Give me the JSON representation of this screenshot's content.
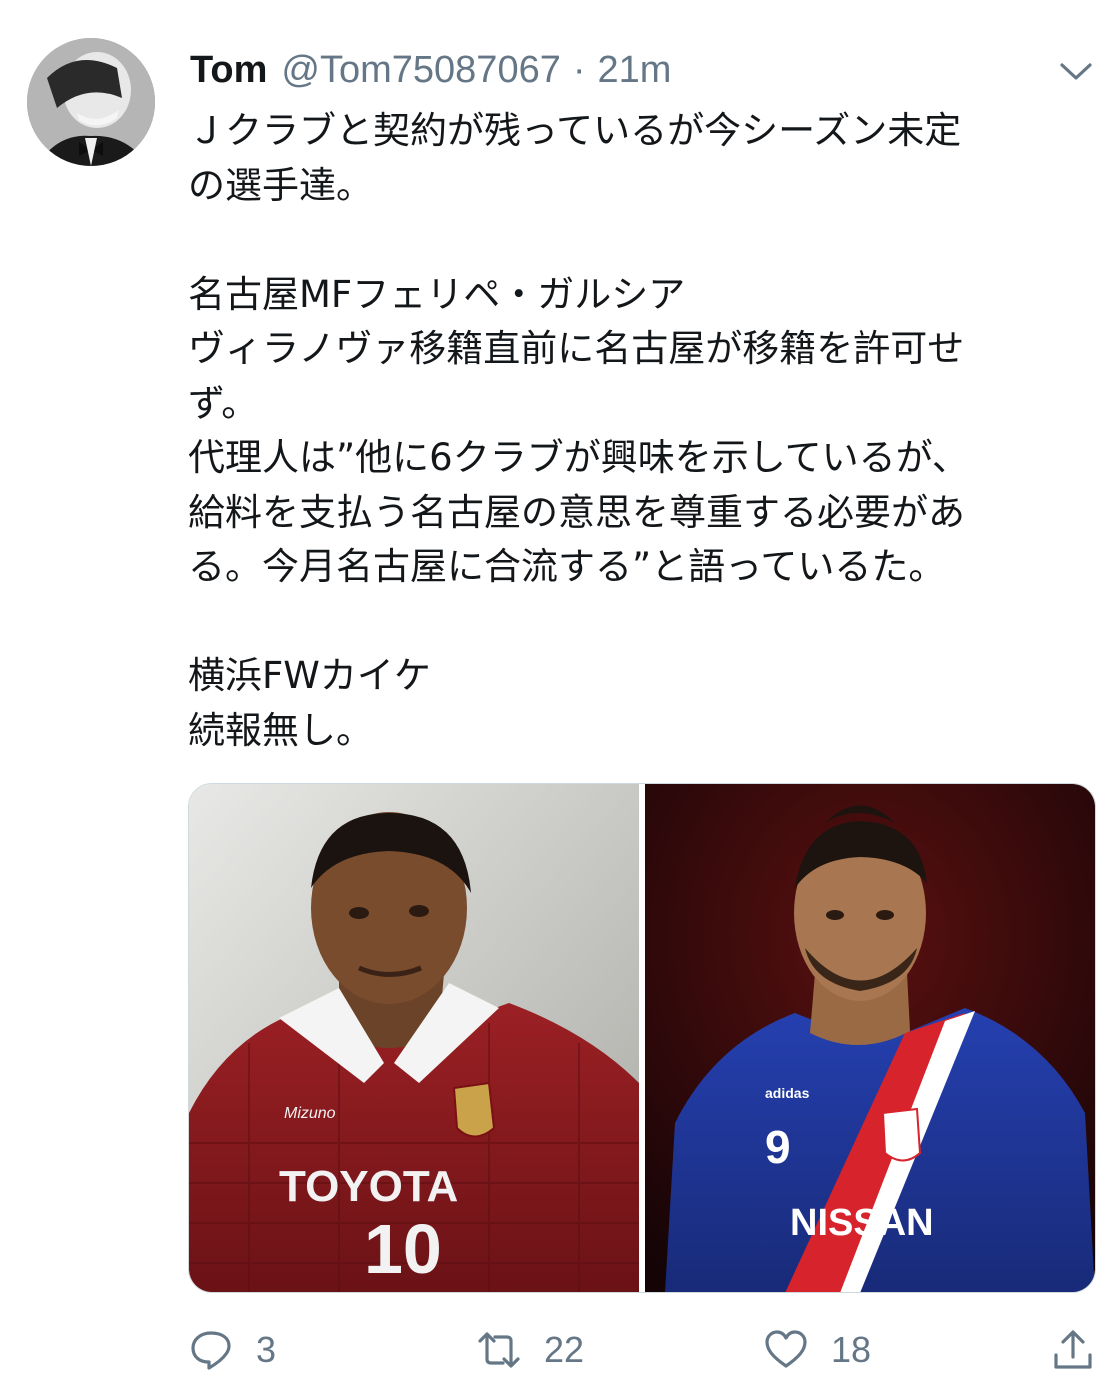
{
  "tweet": {
    "display_name": "Tom",
    "handle": "@Tom75087067",
    "separator": "·",
    "time": "21m",
    "text_lines": [
      "Ｊクラブと契約が残っているが今シーズン未定",
      "の選手達。",
      "",
      "名古屋MFフェリペ・ガルシア",
      "ヴィラノヴァ移籍直前に名古屋が移籍を許可せ",
      "ず。",
      "代理人は”他に6クラブが興味を示しているが、",
      "給料を支払う名古屋の意思を尊重する必要があ",
      "る。今月名古屋に合流する”と語っているた。",
      "",
      "横浜FWカイケ",
      "続報無し。"
    ],
    "photos": [
      {
        "shirt_text": "TOYOTA",
        "number": "10",
        "brand": "Mizuno"
      },
      {
        "shirt_text": "NISSAN",
        "number": "9",
        "brand": "adidas"
      }
    ],
    "actions": {
      "reply_count": "3",
      "retweet_count": "22",
      "like_count": "18"
    }
  },
  "icons": {
    "menu": "chevron-down-icon",
    "reply": "reply-icon",
    "retweet": "retweet-icon",
    "like": "heart-icon",
    "share": "share-icon"
  },
  "colors": {
    "text": "#14171a",
    "secondary": "#657786",
    "nagoya_red": "#8e1b1f",
    "yokohama_blue": "#1e3a9e"
  }
}
